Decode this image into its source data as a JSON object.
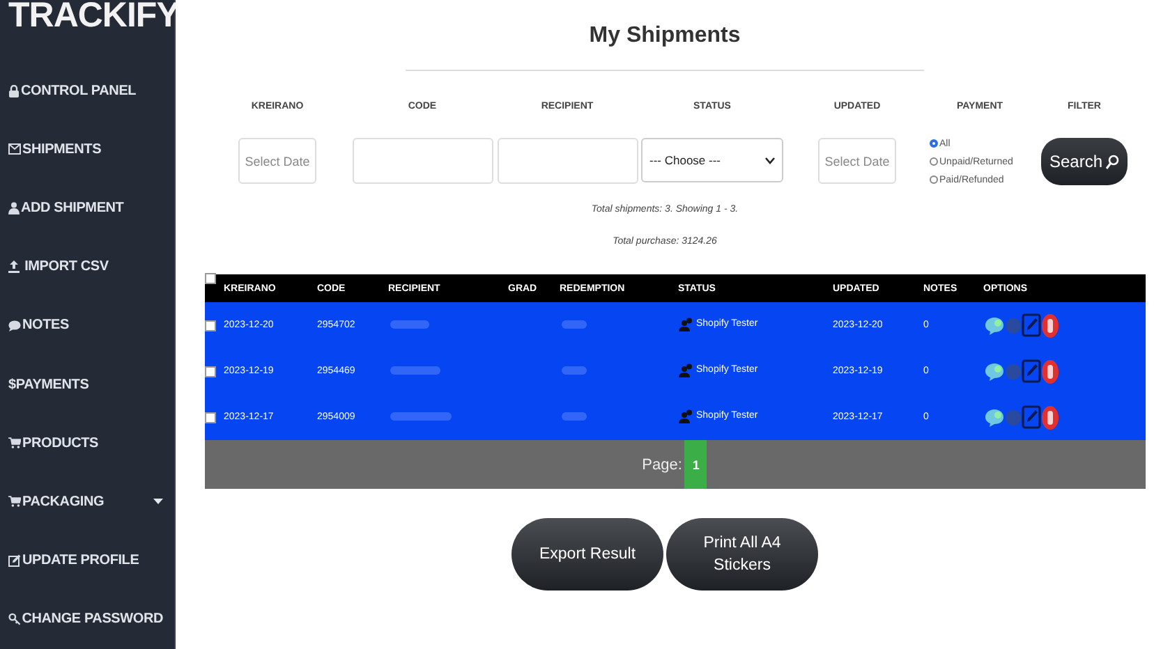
{
  "brand": {
    "name": "TRACKIFY"
  },
  "sidebar": {
    "items": [
      {
        "kind": "lock",
        "label": "CONTROL PANEL",
        "expandable": false
      },
      {
        "kind": "envelope",
        "label": "SHIPMENTS",
        "expandable": false
      },
      {
        "kind": "person",
        "label": "ADD SHIPMENT",
        "expandable": false
      },
      {
        "kind": "upload",
        "label": " IMPORT CSV",
        "expandable": false
      },
      {
        "kind": "chat",
        "label": "NOTES",
        "expandable": false
      },
      {
        "kind": "none",
        "label": "$PAYMENTS",
        "expandable": false
      },
      {
        "kind": "cart",
        "label": "PRODUCTS",
        "expandable": false
      },
      {
        "kind": "cart",
        "label": "PACKAGING",
        "expandable": true
      },
      {
        "kind": "edit",
        "label": "UPDATE PROFILE",
        "expandable": false
      },
      {
        "kind": "key",
        "label": "CHANGE PASSWORD",
        "expandable": false
      }
    ]
  },
  "page": {
    "title": "My Shipments"
  },
  "filters": [
    {
      "kind": "date",
      "heading": "KREIRANO",
      "placeholder": "Select Date"
    },
    {
      "kind": "text",
      "heading": "CODE"
    },
    {
      "kind": "text",
      "heading": "RECIPIENT"
    },
    {
      "kind": "select",
      "heading": "STATUS",
      "value": "--- Choose ---"
    },
    {
      "kind": "date",
      "heading": "UPDATED",
      "placeholder": "Select Date"
    },
    {
      "kind": "radio",
      "heading": "PAYMENT",
      "options": [
        {
          "label": "All",
          "selected": true
        },
        {
          "label": "Unpaid/Returned",
          "selected": false
        },
        {
          "label": "Paid/Refunded",
          "selected": false
        }
      ]
    },
    {
      "kind": "button",
      "heading": "FILTER",
      "label": "Search"
    }
  ],
  "summary": [
    "Total shipments: 3. Showing 1 - 3.",
    "Total purchase: 3124.26"
  ],
  "table": {
    "select_all": {
      "checked": false
    },
    "columns": [
      "KREIRANO",
      "CODE",
      "RECIPIENT",
      "GRAD",
      "REDEMPTION",
      "STATUS",
      "UPDATED",
      "NOTES",
      "OPTIONS"
    ],
    "rows": [
      {
        "checked": false,
        "created": "2023-12-20",
        "code": "2954702",
        "status": "Shopify Tester",
        "updated": "2023-12-20",
        "notes": "0"
      },
      {
        "checked": false,
        "created": "2023-12-19",
        "code": "2954469",
        "status": "Shopify Tester",
        "updated": "2023-12-19",
        "notes": "0"
      },
      {
        "checked": false,
        "created": "2023-12-17",
        "code": "2954009",
        "status": "Shopify Tester",
        "updated": "2023-12-17",
        "notes": "0"
      }
    ]
  },
  "pagination": {
    "label": "Page:",
    "pages": [
      {
        "label": "1",
        "selected": true
      }
    ]
  },
  "actions": [
    {
      "label": "Export Result"
    },
    {
      "label": "Print All A4 Stickers"
    }
  ]
}
